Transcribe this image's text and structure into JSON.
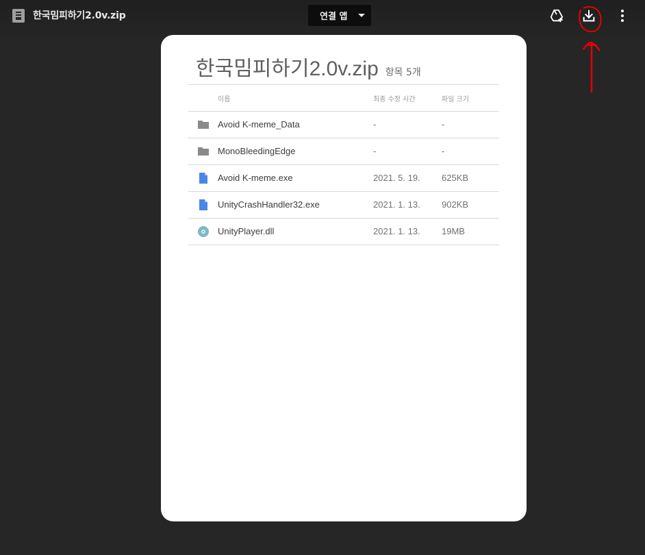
{
  "topbar": {
    "file_icon": "zip-file-icon",
    "file_title": "한국밈피하기2.0v.zip",
    "open_with_label": "연결 앱",
    "icons": [
      "add-to-drive-icon",
      "download-icon",
      "more-vert-icon"
    ]
  },
  "card": {
    "zip_name": "한국밈피하기2.0v.zip",
    "item_count": "항목 5개",
    "columns": {
      "name": "이름",
      "modified": "최종 수정 시간",
      "size": "파일 크기"
    },
    "rows": [
      {
        "icon": "folder-icon",
        "name": "Avoid K-meme_Data",
        "modified": "-",
        "size": "-"
      },
      {
        "icon": "folder-icon",
        "name": "MonoBleedingEdge",
        "modified": "-",
        "size": "-"
      },
      {
        "icon": "document-icon",
        "name": "Avoid K-meme.exe",
        "modified": "2021. 5. 19.",
        "size": "625KB"
      },
      {
        "icon": "document-icon",
        "name": "UnityCrashHandler32.exe",
        "modified": "2021. 1. 13.",
        "size": "902KB"
      },
      {
        "icon": "disc-icon",
        "name": "UnityPlayer.dll",
        "modified": "2021. 1. 13.",
        "size": "19MB"
      }
    ]
  },
  "colors": {
    "background": "#262626",
    "card": "#ffffff",
    "folder": "#8a8a8a",
    "document": "#4a86e8",
    "disc": "#7fb8c4",
    "annotation": "#e60000"
  }
}
